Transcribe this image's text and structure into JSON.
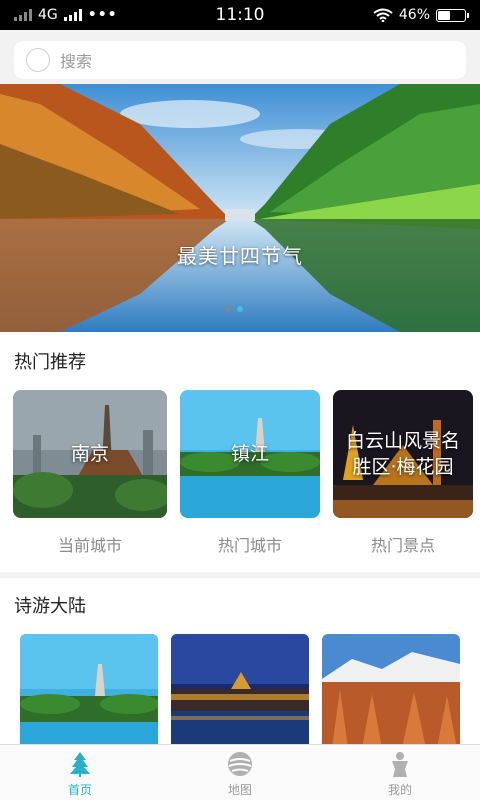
{
  "status_bar": {
    "network": "4G",
    "time": "11:10",
    "battery": "46%",
    "battery_level": 0.46
  },
  "search": {
    "placeholder": "搜索"
  },
  "banner": {
    "caption": "最美廿四节气",
    "page_count": 2,
    "active_page": 2
  },
  "hot_section": {
    "title": "热门推荐",
    "cards": [
      {
        "name": "南京",
        "caption": "当前城市"
      },
      {
        "name": "镇江",
        "caption": "热门城市"
      },
      {
        "name": "白云山风景名胜区·梅花园",
        "caption": "热门景点"
      }
    ]
  },
  "poem_section": {
    "title": "诗游大陆"
  },
  "tabbar": {
    "tabs": [
      {
        "label": "首页",
        "icon": "tree-icon",
        "active": true
      },
      {
        "label": "地图",
        "icon": "map-globe-icon",
        "active": false
      },
      {
        "label": "我的",
        "icon": "person-icon",
        "active": false
      }
    ],
    "active_color": "#2ab0c8"
  }
}
